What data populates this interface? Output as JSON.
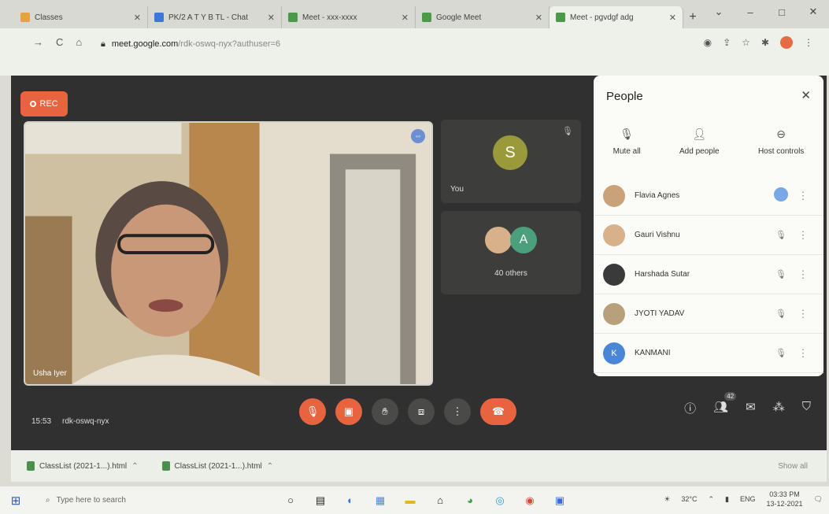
{
  "browser": {
    "tabs": [
      {
        "label": "Classes",
        "color": "#e6a23c"
      },
      {
        "label": "PK/2 A T Y B TL - Chat",
        "color": "#3b78d8"
      },
      {
        "label": "Meet - xxx-xxxx",
        "color": "#4a9a4a"
      },
      {
        "label": "Google Meet",
        "color": "#4a9a4a"
      },
      {
        "label": "Meet - pgvdgf adg",
        "color": "#4a9a4a"
      }
    ],
    "active_tab": 4,
    "url_host": "meet.google.com",
    "url_path": "/rdk-oswq-nyx?authuser=6"
  },
  "meet": {
    "rec_label": "REC",
    "main_speaker": "Usha Iyer",
    "you_initial": "S",
    "you_label": "You",
    "others_initial": "A",
    "others_label": "40 others",
    "time": "15:53",
    "meeting_code": "rdk-oswq-nyx",
    "participants_count": "42"
  },
  "people_panel": {
    "title": "People",
    "actions": {
      "mute_all": "Mute all",
      "add_people": "Add people",
      "host_controls": "Host controls"
    },
    "participants": [
      {
        "name": "Flavia Agnes",
        "avatar_color": "#c9a27a",
        "initial": "",
        "state": "speaking"
      },
      {
        "name": "Gauri Vishnu",
        "avatar_color": "#d8b08a",
        "initial": "",
        "state": "muted"
      },
      {
        "name": "Harshada Sutar",
        "avatar_color": "#3a3a3a",
        "initial": "",
        "state": "muted"
      },
      {
        "name": "JYOTI YADAV",
        "avatar_color": "#b8a07a",
        "initial": "",
        "state": "muted"
      },
      {
        "name": "KANMANI",
        "avatar_color": "#4a86d8",
        "initial": "K",
        "state": "muted"
      }
    ]
  },
  "downloads": [
    {
      "label": "ClassList (2021-1...).html"
    },
    {
      "label": "ClassList (2021-1...).html"
    }
  ],
  "downloads_showall": "Show all",
  "taskbar": {
    "search_placeholder": "Type here to search",
    "temperature": "32°C",
    "lang": "ENG",
    "time": "03:33 PM",
    "date": "13-12-2021"
  }
}
